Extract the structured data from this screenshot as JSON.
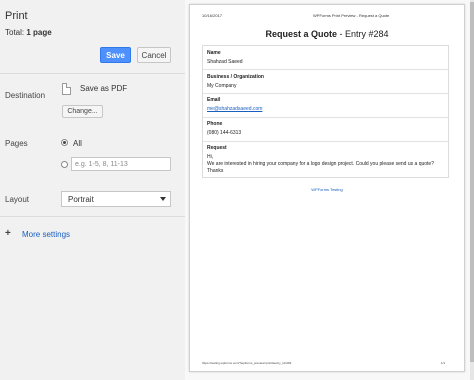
{
  "print_panel": {
    "title": "Print",
    "total_label": "Total:",
    "total_value": "1 page",
    "save_label": "Save",
    "cancel_label": "Cancel",
    "destination": {
      "label": "Destination",
      "value": "Save as PDF",
      "change_label": "Change..."
    },
    "pages": {
      "label": "Pages",
      "option_all": "All",
      "range_placeholder": "e.g. 1-5, 8, 11-13"
    },
    "layout": {
      "label": "Layout",
      "value": "Portrait"
    },
    "more_settings": "More settings"
  },
  "preview": {
    "header_date": "10/16/2017",
    "header_title": "WPForms Print Preview - Request a Quote",
    "doc_title": "Request a Quote",
    "doc_entry": " - Entry #284",
    "fields": [
      {
        "label": "Name",
        "value": "Shahzad Saeed"
      },
      {
        "label": "Business / Organization",
        "value": "My Company"
      },
      {
        "label": "Email",
        "value": "me@shahzadsaeed.com"
      },
      {
        "label": "Phone",
        "value": "(080) 144-6313"
      },
      {
        "label": "Request",
        "lines": [
          "Hi,",
          "We are interested in hiring your company for a logo design project. Could you please send us a quote?",
          "Thanks"
        ]
      }
    ],
    "footer_brand": "WPForms Testing",
    "footer_url": "https://testing.wpforms.com/?wpforms_preview=print&entry_id=284",
    "footer_page": "1/1"
  },
  "colors": {
    "accent": "#4d90fe",
    "link": "#1a5fc0",
    "panel_bg": "#f1f1f1"
  }
}
